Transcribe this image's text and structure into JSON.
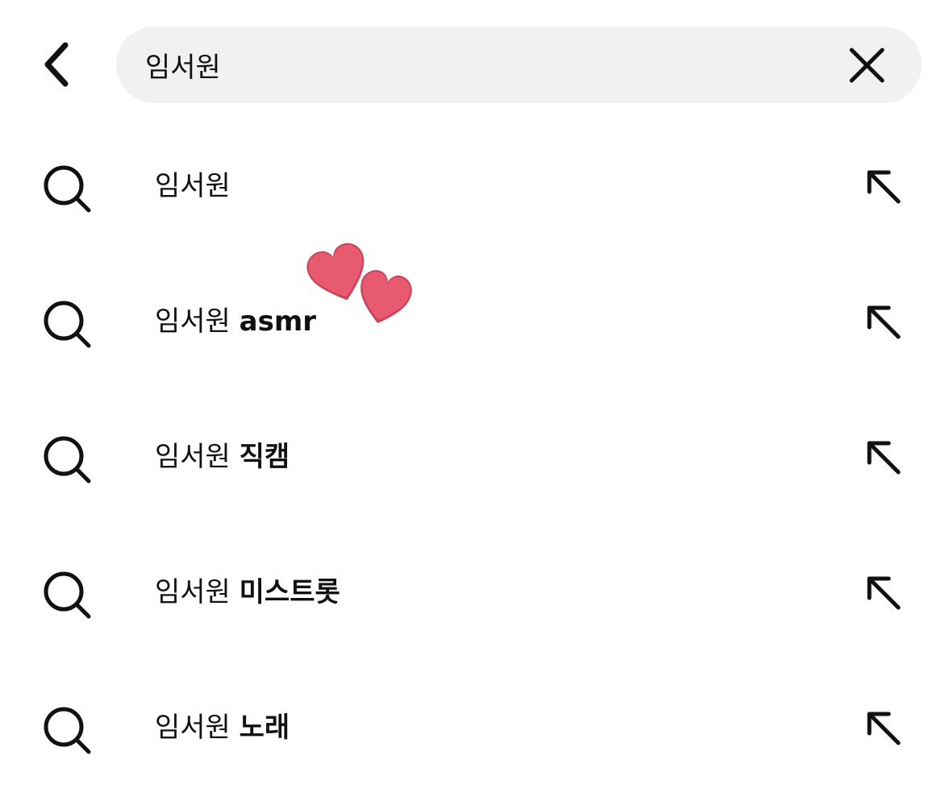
{
  "header": {
    "back_icon": "chevron-left-icon",
    "search": {
      "value": "임서원",
      "clear_icon": "close-icon"
    }
  },
  "suggestions": [
    {
      "query": "임서원",
      "suffix": ""
    },
    {
      "query": "임서원",
      "suffix": "asmr"
    },
    {
      "query": "임서원",
      "suffix": "직캠"
    },
    {
      "query": "임서원",
      "suffix": "미스트롯"
    },
    {
      "query": "임서원",
      "suffix": "노래"
    }
  ],
  "icons": {
    "row_icon": "search-icon",
    "fill_icon": "arrow-up-left-icon",
    "sticker": "two-hearts-icon"
  },
  "colors": {
    "text": "#111111",
    "search_bg": "#f1f1f1",
    "heart": "#e85a70"
  }
}
